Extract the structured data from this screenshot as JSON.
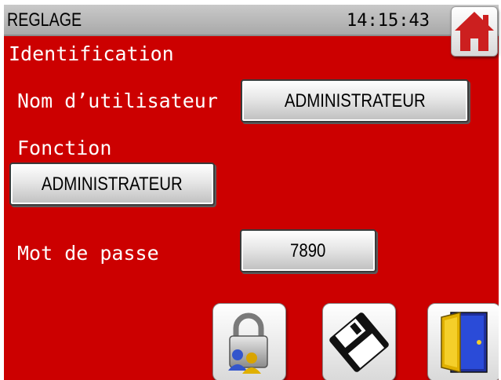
{
  "header": {
    "title": "REGLAGE",
    "clock": "14:15:43"
  },
  "section": {
    "heading": "Identification"
  },
  "user": {
    "label": "Nom d’utilisateur",
    "value": "ADMINISTRATEUR"
  },
  "function": {
    "label": "Fonction",
    "value": "ADMINISTRATEUR"
  },
  "password": {
    "label": "Mot de passe",
    "value": "7890"
  },
  "toolbar": {
    "icons": [
      "lock-users-icon",
      "floppy-disk-icon",
      "exit-door-icon"
    ]
  },
  "colors": {
    "background": "#cc0000",
    "titlebar": "#b5b5b5",
    "home_icon": "#cc1f1f"
  }
}
